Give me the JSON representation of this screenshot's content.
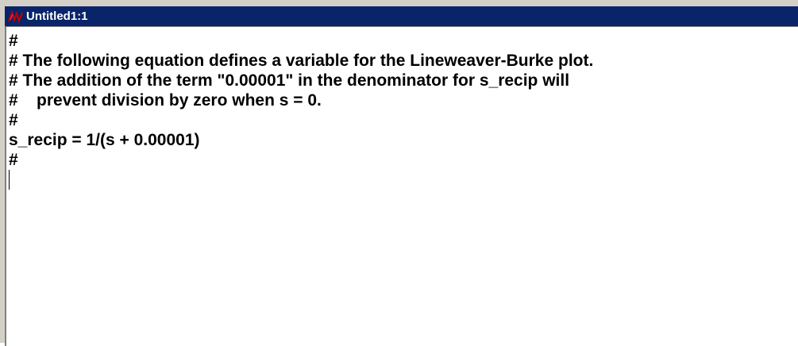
{
  "window": {
    "title": "Untitled1:1",
    "icon": "sigmaplot-transform-icon"
  },
  "editor": {
    "lines": [
      "#",
      "# The following equation defines a variable for the Lineweaver-Burke plot.",
      "# The addition of the term \"0.00001\" in the denominator for s_recip will",
      "#    prevent division by zero when s = 0.",
      "#",
      "s_recip = 1/(s + 0.00001)",
      "#"
    ]
  },
  "colors": {
    "titlebar": "#0a246a",
    "title_text": "#ffffff",
    "frame": "#d4d0c8",
    "editor_bg": "#ffffff"
  }
}
